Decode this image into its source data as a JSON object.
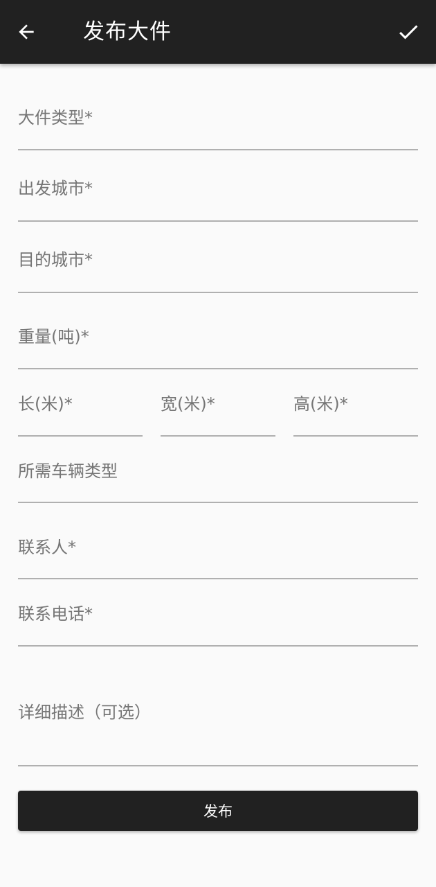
{
  "toolbar": {
    "title": "发布大件",
    "back_icon": "arrow-back-icon",
    "confirm_icon": "check-icon",
    "background_color": "#212121",
    "text_color": "#ffffff"
  },
  "form": {
    "cargo_type": {
      "placeholder": "大件类型*",
      "value": ""
    },
    "departure_city": {
      "placeholder": "出发城市*",
      "value": ""
    },
    "destination_city": {
      "placeholder": "目的城市*",
      "value": ""
    },
    "weight": {
      "placeholder": "重量(吨)*",
      "value": ""
    },
    "length": {
      "placeholder": "长(米)*",
      "value": ""
    },
    "width": {
      "placeholder": "宽(米)*",
      "value": ""
    },
    "height": {
      "placeholder": "高(米)*",
      "value": ""
    },
    "vehicle_type": {
      "placeholder": "所需车辆类型",
      "value": ""
    },
    "contact_person": {
      "placeholder": "联系人*",
      "value": ""
    },
    "contact_phone": {
      "placeholder": "联系电话*",
      "value": ""
    },
    "description": {
      "placeholder": "详细描述（可选）",
      "value": ""
    }
  },
  "submit": {
    "label": "发布",
    "background_color": "#212121"
  }
}
